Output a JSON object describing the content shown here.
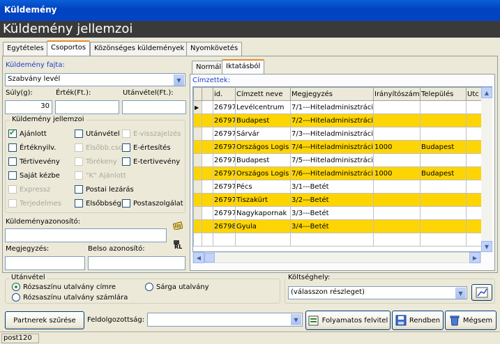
{
  "window": {
    "title": "Küldemény"
  },
  "header": {
    "title": "Küldemény jellemzoi"
  },
  "tabs": [
    "Egytételes",
    "Csoportos",
    "Közönséges küldemények",
    "Nyomkövetés"
  ],
  "form": {
    "type_label": "Küldemény fajta:",
    "type_value": "Szabvány levél",
    "weight_label": "Súly(g):",
    "weight_value": "30",
    "value_label": "Érték(Ft.):",
    "value_value": "",
    "cod_label": "Utánvétel(Ft.):",
    "cod_value": "",
    "props_legend": "Küldemény jellemzoi",
    "checkboxes": [
      {
        "label": "Ajánlott",
        "checked": true,
        "enabled": true
      },
      {
        "label": "Utánvétel",
        "checked": false,
        "enabled": true
      },
      {
        "label": "E-visszajelzés",
        "checked": false,
        "enabled": false
      },
      {
        "label": "Értéknyilv.",
        "checked": false,
        "enabled": true
      },
      {
        "label": "Elsőbb.cso",
        "checked": false,
        "enabled": false
      },
      {
        "label": "E-értesítés",
        "checked": false,
        "enabled": true
      },
      {
        "label": "Tértivevény",
        "checked": false,
        "enabled": true
      },
      {
        "label": "Törékeny",
        "checked": false,
        "enabled": false
      },
      {
        "label": "E-tertivevény",
        "checked": false,
        "enabled": true
      },
      {
        "label": "Saját kézbe",
        "checked": false,
        "enabled": true
      },
      {
        "label": "\"K\" Ajánlott",
        "checked": false,
        "enabled": false
      },
      {
        "label": "Expressz",
        "checked": false,
        "enabled": false
      },
      {
        "label": "Postai lezárás",
        "checked": false,
        "enabled": true
      },
      {
        "label": "Terjedelmes",
        "checked": false,
        "enabled": false
      },
      {
        "label": "Elsőbbségi",
        "checked": false,
        "enabled": true
      },
      {
        "label": "Postaszolgálat",
        "checked": false,
        "enabled": true
      }
    ],
    "id_label": "Küldeményazonosító:",
    "id_value": "",
    "note_label": "Megjegyzés:",
    "note_value": "",
    "internal_label": "Belso azonosító:",
    "internal_value": ""
  },
  "right": {
    "subtabs": [
      "Normál",
      "Iktatásból"
    ],
    "recipients_label": "Címzettek:",
    "columns": [
      "id.",
      "Címzett neve",
      "Megjegyzés",
      "Irányítószám",
      "Település",
      "Utc"
    ],
    "rows": [
      {
        "id": "26797",
        "name": "Levélcentrum",
        "note": "7/1---Hiteladminisztráció",
        "zip": "",
        "city": "",
        "hl": false
      },
      {
        "id": "26797",
        "name": "Budapest",
        "note": "7/2---Hiteladminisztráció",
        "zip": "",
        "city": "",
        "hl": true
      },
      {
        "id": "26797",
        "name": "Sárvár",
        "note": "7/3---Hiteladminisztráció",
        "zip": "",
        "city": "",
        "hl": false
      },
      {
        "id": "26797",
        "name": "Országos Logis",
        "note": "7/4---Hiteladminisztráció",
        "zip": "1000",
        "city": "Budapest",
        "hl": true
      },
      {
        "id": "26797",
        "name": "Budapest",
        "note": "7/5---Hiteladminisztráció",
        "zip": "",
        "city": "",
        "hl": false
      },
      {
        "id": "26797",
        "name": "Országos Logis",
        "note": "7/6---Hiteladminisztráció",
        "zip": "1000",
        "city": "Budapest",
        "hl": true
      },
      {
        "id": "26797",
        "name": "Pécs",
        "note": "3/1---Betét",
        "zip": "",
        "city": "",
        "hl": false
      },
      {
        "id": "26797",
        "name": "Tiszakürt",
        "note": "3/2---Betét",
        "zip": "",
        "city": "",
        "hl": true
      },
      {
        "id": "26797",
        "name": "Nagykapornak",
        "note": "3/3---Betét",
        "zip": "",
        "city": "",
        "hl": false
      },
      {
        "id": "26798",
        "name": "Gyula",
        "note": "3/4---Betét",
        "zip": "",
        "city": "",
        "hl": true
      }
    ]
  },
  "cod_group": {
    "legend": "Utánvétel",
    "options": [
      "Rózsaszínu utalvány címre",
      "Sárga utalvány",
      "Rózsaszínu utalvány számlára"
    ]
  },
  "cost": {
    "label": "Költséghely:",
    "value": "(válasszon részleget)"
  },
  "bottom": {
    "filter_button": "Partnerek szűrése",
    "processed_label": "Feldolgozottság:",
    "processed_value": "",
    "continuous_button": "Folyamatos felvitel",
    "ok_button": "Rendben",
    "cancel_button": "Mégsem"
  },
  "status": {
    "text": "post120"
  }
}
